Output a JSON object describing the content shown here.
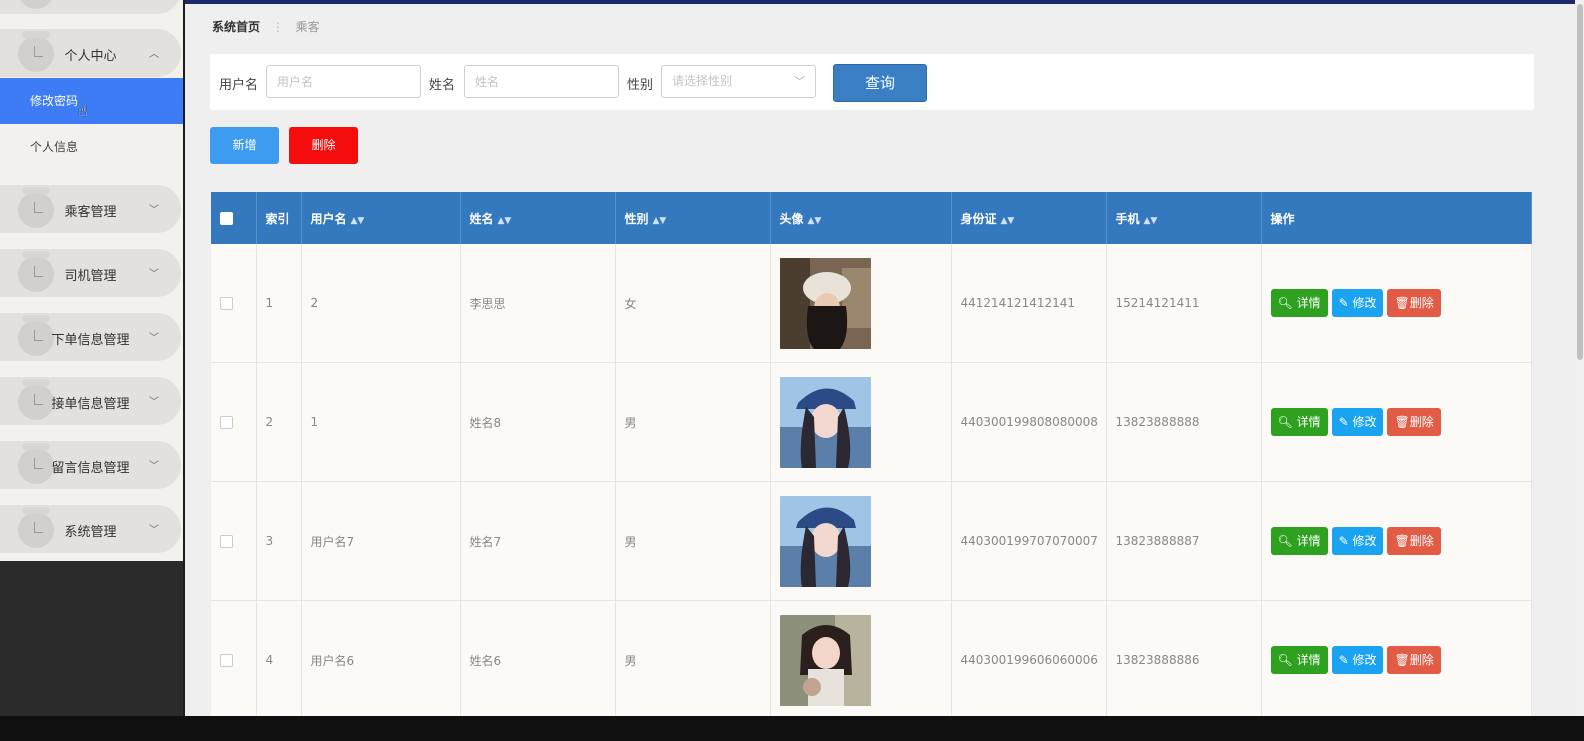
{
  "sidebar": {
    "group_personal": "个人中心",
    "sub_change_password": "修改密码",
    "sub_profile": "个人信息",
    "items": [
      "乘客管理",
      "司机管理",
      "下单信息管理",
      "接单信息管理",
      "留言信息管理",
      "系统管理"
    ]
  },
  "breadcrumb": {
    "home": "系统首页",
    "separator": "⋮",
    "current": "乘客"
  },
  "search": {
    "username_label": "用户名",
    "username_placeholder": "用户名",
    "name_label": "姓名",
    "name_placeholder": "姓名",
    "gender_label": "性别",
    "gender_placeholder": "请选择性别",
    "query_label": "查询"
  },
  "actions": {
    "add_label": "新增",
    "delete_label": "删除"
  },
  "table": {
    "headers": [
      "索引",
      "用户名",
      "姓名",
      "性别",
      "头像",
      "身份证",
      "手机",
      "操作"
    ],
    "rows": [
      {
        "index": "1",
        "username": "2",
        "name": "李思思",
        "gender": "女",
        "id_card": "441214121412141",
        "phone": "15214121411"
      },
      {
        "index": "2",
        "username": "1",
        "name": "姓名8",
        "gender": "男",
        "id_card": "440300199808080008",
        "phone": "13823888888"
      },
      {
        "index": "3",
        "username": "用户名7",
        "name": "姓名7",
        "gender": "男",
        "id_card": "440300199707070007",
        "phone": "13823888887"
      },
      {
        "index": "4",
        "username": "用户名6",
        "name": "姓名6",
        "gender": "男",
        "id_card": "440300199606060006",
        "phone": "13823888886"
      }
    ],
    "op_detail": "详情",
    "op_edit": "修改",
    "op_delete": "删除"
  },
  "colors": {
    "active_menu": "#3d7cf4",
    "header_blue": "#3479be",
    "detail_green": "#2ea121",
    "edit_blue": "#1aa3f0",
    "delete_red": "#e25b45",
    "add_blue": "#3d9bf0",
    "delete_batch_red": "#f50c0c"
  }
}
